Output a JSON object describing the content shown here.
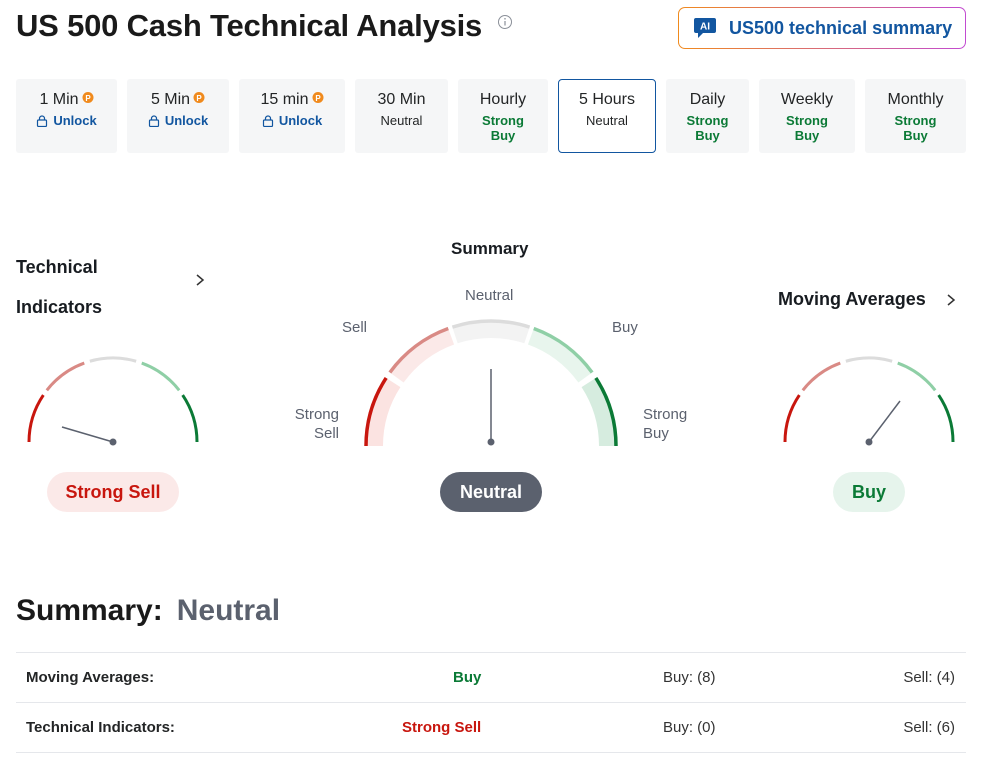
{
  "page": {
    "title": "US 500 Cash Technical Analysis",
    "ai_button_label": "US500 technical summary",
    "ai_badge": "AI"
  },
  "tabs": [
    {
      "title": "1 Min",
      "sub": "Unlock",
      "type": "unlock",
      "pro": true
    },
    {
      "title": "5 Min",
      "sub": "Unlock",
      "type": "unlock",
      "pro": true
    },
    {
      "title": "15 min",
      "sub": "Unlock",
      "type": "unlock",
      "pro": true
    },
    {
      "title": "30 Min",
      "sub": "Neutral",
      "type": "neutral",
      "pro": false
    },
    {
      "title": "Hourly",
      "sub": "Strong Buy",
      "type": "buy",
      "pro": false
    },
    {
      "title": "5 Hours",
      "sub": "Neutral",
      "type": "neutral",
      "pro": false,
      "active": true
    },
    {
      "title": "Daily",
      "sub": "Strong Buy",
      "type": "buy",
      "pro": false
    },
    {
      "title": "Weekly",
      "sub": "Strong Buy",
      "type": "buy",
      "pro": false
    },
    {
      "title": "Monthly",
      "sub": "Strong Buy",
      "type": "buy",
      "pro": false
    }
  ],
  "gauges": {
    "technical_indicators": {
      "title_line1": "Technical",
      "title_line2": "Indicators",
      "result": "Strong Sell"
    },
    "summary": {
      "title": "Summary",
      "result": "Neutral",
      "labels": {
        "neutral": "Neutral",
        "sell": "Sell",
        "buy": "Buy",
        "strong_sell_1": "Strong",
        "strong_sell_2": "Sell",
        "strong_buy_1": "Strong",
        "strong_buy_2": "Buy"
      }
    },
    "moving_averages": {
      "title": "Moving Averages",
      "result": "Buy"
    }
  },
  "summary": {
    "label": "Summary:",
    "value": "Neutral",
    "rows": [
      {
        "name": "Moving Averages:",
        "signal": "Buy",
        "buy": "Buy: (8)",
        "sell": "Sell: (4)"
      },
      {
        "name": "Technical Indicators:",
        "signal": "Strong Sell",
        "buy": "Buy: (0)",
        "sell": "Sell: (6)"
      }
    ]
  },
  "colors": {
    "strong_sell": "#c8160e",
    "sell": "#d98a85",
    "neutral": "#dcdcdc",
    "buy": "#8fcfa6",
    "strong_buy": "#0b7a36",
    "accent": "#1256a0"
  }
}
